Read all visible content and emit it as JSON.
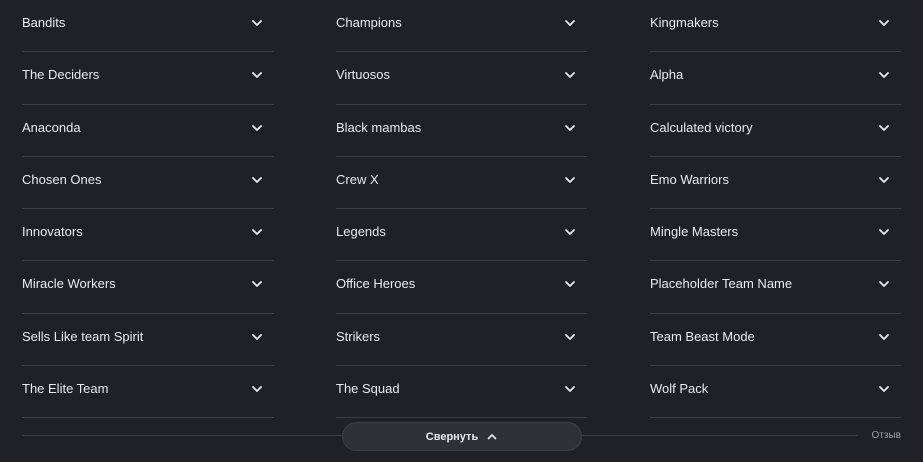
{
  "columns": [
    {
      "items": [
        {
          "label": "Bandits"
        },
        {
          "label": "The Deciders"
        },
        {
          "label": "Anaconda"
        },
        {
          "label": "Chosen Ones"
        },
        {
          "label": "Innovators"
        },
        {
          "label": "Miracle Workers"
        },
        {
          "label": "Sells Like team Spirit"
        },
        {
          "label": "The Elite Team"
        }
      ]
    },
    {
      "items": [
        {
          "label": "Champions"
        },
        {
          "label": "Virtuosos"
        },
        {
          "label": "Black mambas"
        },
        {
          "label": "Crew X"
        },
        {
          "label": "Legends"
        },
        {
          "label": "Office Heroes"
        },
        {
          "label": "Strikers"
        },
        {
          "label": "The Squad"
        }
      ]
    },
    {
      "items": [
        {
          "label": "Kingmakers"
        },
        {
          "label": "Alpha"
        },
        {
          "label": "Calculated victory"
        },
        {
          "label": "Emo Warriors"
        },
        {
          "label": "Mingle Masters"
        },
        {
          "label": "Placeholder Team Name"
        },
        {
          "label": "Team Beast Mode"
        },
        {
          "label": "Wolf Pack"
        }
      ]
    }
  ],
  "footer": {
    "collapse_label": "Свернуть",
    "collapse_icon": "chevron-up-icon",
    "feedback_label": "Отзыв"
  },
  "icons": {
    "item_expand": "chevron-down-icon"
  },
  "colors": {
    "background": "#202124",
    "text": "#e8eaed",
    "divider": "#3c4043",
    "button_bg": "#303134",
    "muted_text": "#9aa0a6"
  }
}
